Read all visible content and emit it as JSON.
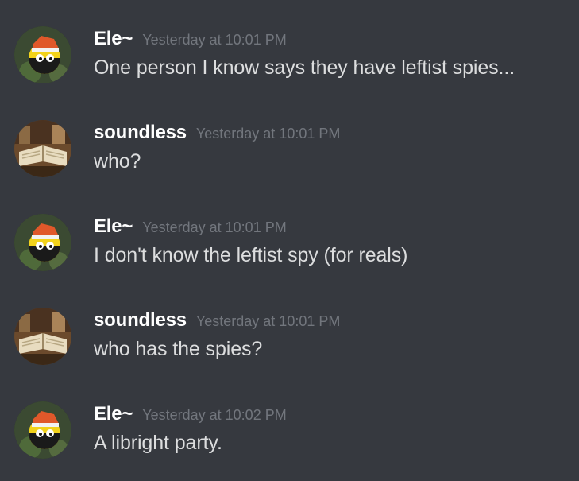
{
  "theme": {
    "background": "#36393f",
    "username_color": "#ffffff",
    "timestamp_color": "#72767d",
    "text_color": "#dcddde"
  },
  "messages": [
    {
      "author": "Ele~",
      "timestamp": "Yesterday at 10:01 PM",
      "text": "One person I know says they have leftist spies...",
      "avatar": "countryball-avatar-icon"
    },
    {
      "author": "soundless",
      "timestamp": "Yesterday at 10:01 PM",
      "text": "who?",
      "avatar": "books-avatar-icon"
    },
    {
      "author": "Ele~",
      "timestamp": "Yesterday at 10:01 PM",
      "text": "I don't know the leftist spy (for reals)",
      "avatar": "countryball-avatar-icon"
    },
    {
      "author": "soundless",
      "timestamp": "Yesterday at 10:01 PM",
      "text": "who has the spies?",
      "avatar": "books-avatar-icon"
    },
    {
      "author": "Ele~",
      "timestamp": "Yesterday at 10:02 PM",
      "text": "A libright party.",
      "avatar": "countryball-avatar-icon"
    }
  ]
}
